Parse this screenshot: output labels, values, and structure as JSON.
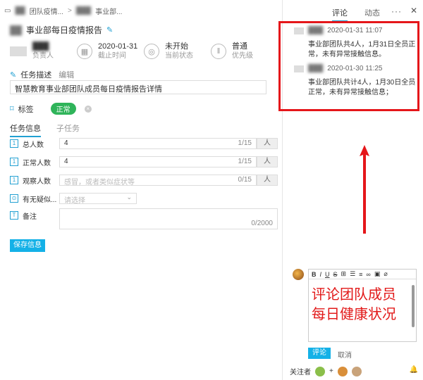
{
  "breadcrumb": {
    "items": [
      "团队疫情...",
      "事业部..."
    ]
  },
  "task": {
    "title": "事业部每日疫情报告",
    "assignee_label": "负责人",
    "deadline_value": "2020-01-31",
    "deadline_label": "截止时间",
    "status_value": "未开始",
    "status_label": "当前状态",
    "priority_value": "普通",
    "priority_label": "优先级"
  },
  "description": {
    "label": "任务描述",
    "edit": "编辑",
    "text": "智慧教育事业部团队成员每日疫情报告详情"
  },
  "tags": {
    "label": "标签",
    "tag": "正常"
  },
  "tabs": {
    "info": "任务信息",
    "subtask": "子任务"
  },
  "form": {
    "total": {
      "label": "总人数",
      "value": "4",
      "count": "1/15",
      "unit": "人"
    },
    "normal": {
      "label": "正常人数",
      "value": "4",
      "count": "1/15",
      "unit": "人"
    },
    "observe": {
      "label": "观察人数",
      "placeholder": "感冒，或者类似症状等",
      "count": "0/15",
      "unit": "人"
    },
    "suspect": {
      "label": "有无疑似...",
      "placeholder": "请选择"
    },
    "note": {
      "label": "备注",
      "count": "0/2000"
    },
    "save": "保存信息"
  },
  "right": {
    "tab_comment": "评论",
    "tab_activity": "动态",
    "comments": [
      {
        "time": "2020-01-31 11:07",
        "text": "事业部团队共4人，1月31日全员正常，未有异常接触信息。"
      },
      {
        "time": "2020-01-30 11:25",
        "text": "事业部团队共计4人，1月30日全员正常，未有异常接触信息；"
      }
    ],
    "editor_text_line1": "评论团队成员",
    "editor_text_line2": "每日健康状况",
    "submit": "评论",
    "cancel": "取消",
    "followers_label": "关注者"
  },
  "colors": {
    "accent": "#14b1e7",
    "highlight": "#e5161a",
    "tag": "#2fb45a"
  }
}
